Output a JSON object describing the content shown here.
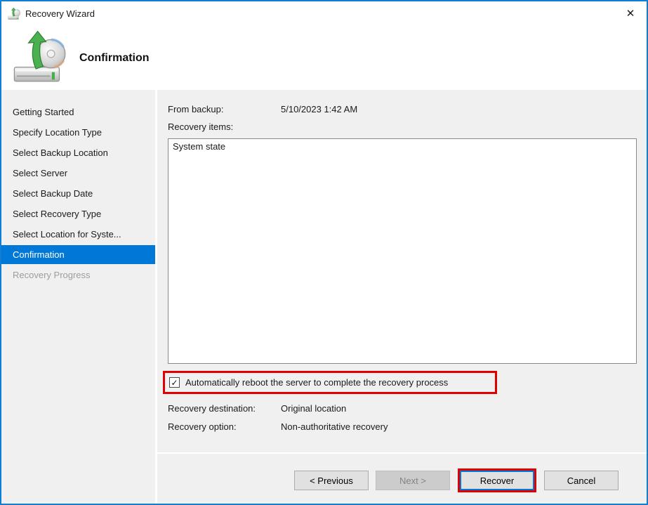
{
  "window": {
    "title": "Recovery Wizard",
    "icons": {
      "app": "recovery-wizard-icon",
      "close": "✕"
    }
  },
  "header": {
    "title": "Confirmation"
  },
  "sidebar": {
    "items": [
      {
        "label": "Getting Started",
        "state": "normal"
      },
      {
        "label": "Specify Location Type",
        "state": "normal"
      },
      {
        "label": "Select Backup Location",
        "state": "normal"
      },
      {
        "label": "Select Server",
        "state": "normal"
      },
      {
        "label": "Select Backup Date",
        "state": "normal"
      },
      {
        "label": "Select Recovery Type",
        "state": "normal"
      },
      {
        "label": "Select Location for Syste...",
        "state": "normal"
      },
      {
        "label": "Confirmation",
        "state": "active"
      },
      {
        "label": "Recovery Progress",
        "state": "disabled"
      }
    ]
  },
  "main": {
    "from_backup": {
      "label": "From backup:",
      "value": "5/10/2023 1:42 AM"
    },
    "recovery_items": {
      "label": "Recovery items:",
      "items": [
        "System state"
      ]
    },
    "reboot_checkbox": {
      "checked": true,
      "glyph": "✓",
      "label": "Automatically reboot the server to complete the recovery process"
    },
    "recovery_destination": {
      "label": "Recovery destination:",
      "value": "Original location"
    },
    "recovery_option": {
      "label": "Recovery option:",
      "value": "Non-authoritative recovery"
    }
  },
  "footer": {
    "buttons": {
      "previous": "< Previous",
      "next": "Next >",
      "recover": "Recover",
      "cancel": "Cancel"
    }
  },
  "colors": {
    "accent_blue": "#0078d7",
    "annotation_red": "#e10000",
    "content_bg": "#f0f0f0"
  }
}
